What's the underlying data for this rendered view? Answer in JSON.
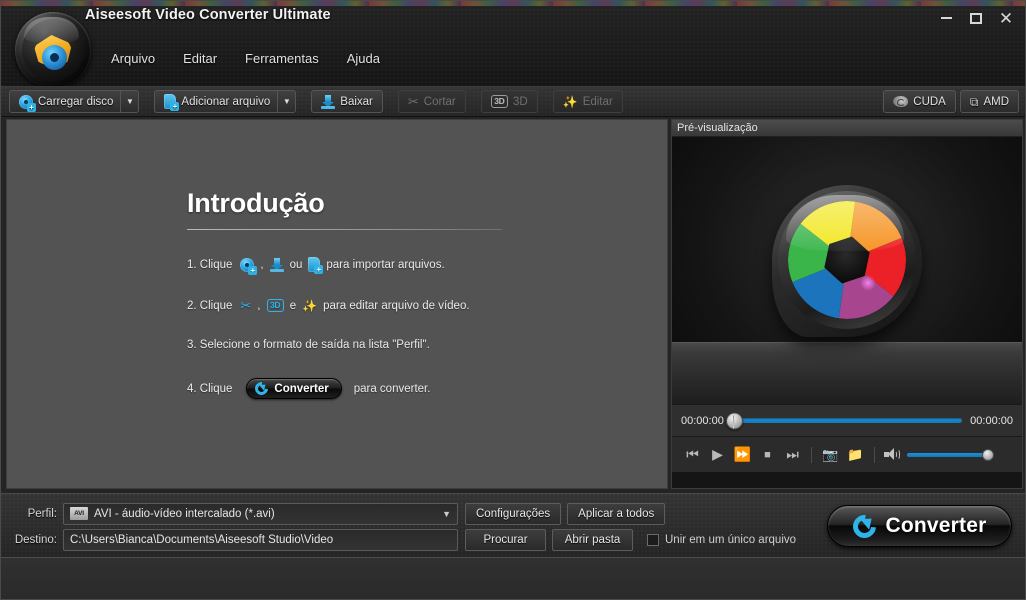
{
  "window": {
    "title": "Aiseesoft Video Converter Ultimate",
    "minimize_label": "Minimizar",
    "maximize_label": "Maximizar",
    "close_label": "Fechar",
    "logo_icon": "aiseesoft-logo-icon"
  },
  "menubar": {
    "items": [
      {
        "label": "Arquivo"
      },
      {
        "label": "Editar"
      },
      {
        "label": "Ferramentas"
      },
      {
        "label": "Ajuda"
      }
    ]
  },
  "toolbar": {
    "left": [
      {
        "label": "Carregar disco",
        "icon": "disc-add-icon",
        "enabled": true,
        "has_dropdown": true
      },
      {
        "label": "Adicionar arquivo",
        "icon": "file-add-icon",
        "enabled": true,
        "has_dropdown": true
      },
      {
        "label": "Baixar",
        "icon": "download-icon",
        "enabled": true,
        "has_dropdown": false
      },
      {
        "label": "Cortar",
        "icon": "scissors-icon",
        "enabled": false,
        "has_dropdown": false
      },
      {
        "label": "3D",
        "icon": "3d-icon",
        "enabled": false,
        "has_dropdown": false
      },
      {
        "label": "Editar",
        "icon": "sparkle-icon",
        "enabled": false,
        "has_dropdown": false
      }
    ],
    "right": [
      {
        "label": "CUDA",
        "icon": "nvidia-cuda-icon"
      },
      {
        "label": "AMD",
        "icon": "amd-icon"
      }
    ]
  },
  "intro": {
    "heading": "Introdução",
    "steps": [
      {
        "number": "1. Clique",
        "icons": [
          "disc-add-icon",
          "download-icon",
          "file-add-icon"
        ],
        "sep1": ",",
        "sep2": "ou",
        "tail": "para importar arquivos."
      },
      {
        "number": "2. Clique",
        "icons": [
          "scissors-icon",
          "3d-icon",
          "sparkle-icon"
        ],
        "sep1": ",",
        "sep2": "e",
        "tail": "para editar arquivo de vídeo."
      },
      {
        "number": "3. Selecione o formato de saída na lista \"Perfil\"."
      },
      {
        "number": "4. Clique",
        "button_label": "Converter",
        "tail": "para converter."
      }
    ]
  },
  "preview": {
    "header": "Pré-visualização",
    "logo_icon": "camera-aperture-icon",
    "time_current": "00:00:00",
    "time_total": "00:00:00",
    "seek_percent": 0,
    "volume_percent": 100,
    "controls": [
      {
        "name": "previous",
        "glyph": "❘◀"
      },
      {
        "name": "play",
        "glyph": "▶"
      },
      {
        "name": "fast-forward",
        "glyph": "▶▶"
      },
      {
        "name": "stop",
        "glyph": "■"
      },
      {
        "name": "next",
        "glyph": "▶❘"
      },
      {
        "name": "snapshot",
        "glyph": "camera"
      },
      {
        "name": "open-folder",
        "glyph": "folder"
      }
    ]
  },
  "bottom": {
    "profile_label": "Perfil:",
    "profile_value": "AVI - áudio-vídeo intercalado (*.avi)",
    "profile_icon": "avi-format-icon",
    "profile_badge": "AVI",
    "settings_button": "Configurações",
    "apply_all_button": "Aplicar a todos",
    "destination_label": "Destino:",
    "destination_value": "C:\\Users\\Bianca\\Documents\\Aiseesoft Studio\\Video",
    "browse_button": "Procurar",
    "open_folder_button": "Abrir pasta",
    "merge_checkbox_label": "Unir em um único arquivo",
    "merge_checked": false,
    "convert_button": "Converter"
  },
  "colors": {
    "accent_blue": "#2fb4ea",
    "slider_blue": "#1e8fd6",
    "panel_gray": "#535353",
    "chrome_dark": "#1b1b1b",
    "text_light": "#e6e6e6"
  }
}
